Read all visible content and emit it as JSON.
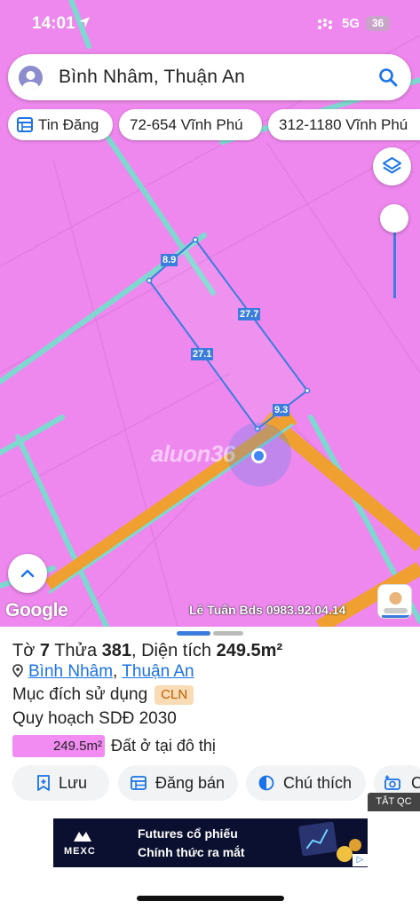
{
  "status_bar": {
    "time": "14:01",
    "network": "5G",
    "battery": "36"
  },
  "search": {
    "text": "Bình Nhâm, Thuận An"
  },
  "chips": [
    {
      "label": "Tin Đăng"
    },
    {
      "label": "72-654 Vĩnh Phú"
    },
    {
      "label": "312-1180 Vĩnh Phú"
    }
  ],
  "map": {
    "dimensions": {
      "top": "8.9",
      "right": "27.7",
      "left": "27.1",
      "bottom": "9.3"
    },
    "watermark": "aluon36",
    "google": "Google",
    "contact": "Lê Tuấn Bds 0983.92.04.14",
    "colors": {
      "land": "#ee88ee",
      "road": "#f0a030",
      "boundary": "#7fd8d0",
      "measure": "#3b7ddd"
    }
  },
  "parcel": {
    "title_prefix": "Tờ ",
    "sheet_no": "7",
    "title_mid": " Thửa ",
    "plot_no": "381",
    "title_suffix": ", Diện tích ",
    "area": "249.5m²",
    "ward": "Bình Nhâm",
    "sep": ",",
    "district": "Thuận An",
    "purpose_label": "Mục đích sử dụng",
    "purpose_code": "CLN",
    "plan_label": "Quy hoạch SDĐ 2030",
    "plan_area": "249.5m²",
    "plan_desc": "Đất ở tại đô thị"
  },
  "actions": [
    {
      "label": "Lưu"
    },
    {
      "label": "Đăng bán"
    },
    {
      "label": "Chú thích"
    },
    {
      "label": "C"
    }
  ],
  "ad": {
    "close_label": "TẮT QC",
    "brand": "MEXC",
    "line1": "Futures cổ phiếu",
    "line2": "Chính thức ra mắt"
  }
}
